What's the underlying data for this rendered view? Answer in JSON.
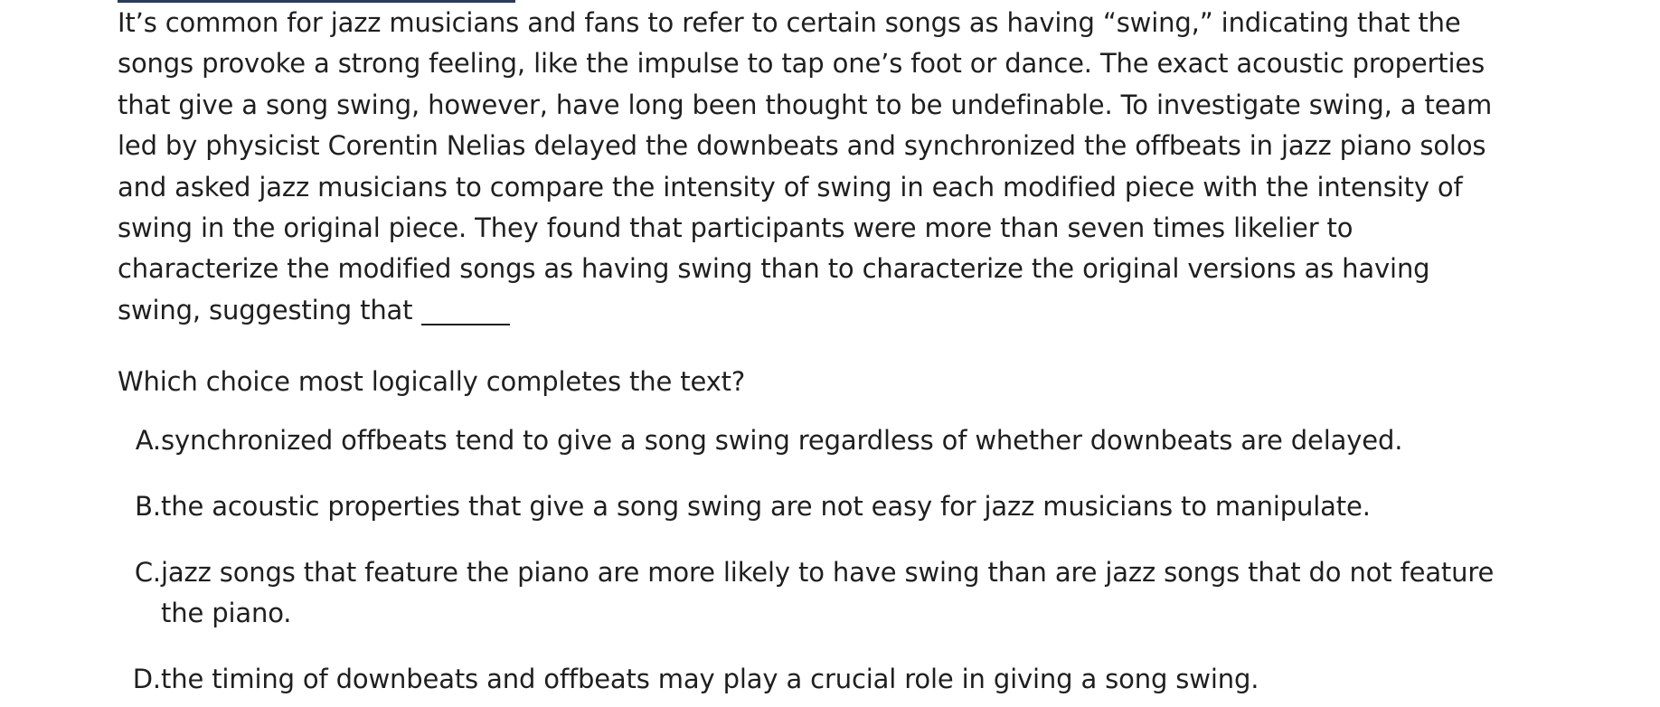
{
  "passage": {
    "text": "It’s common for jazz musicians and fans to refer to certain songs as having “swing,” indicating that the songs provoke a strong feeling, like the impulse to tap one’s foot or dance. The exact acoustic properties that give a song swing, however, have long been thought to be undefinable. To investigate swing, a team led by physicist Corentin Nelias delayed the downbeats and synchronized the offbeats in jazz piano solos and asked jazz musicians to compare the intensity of swing in each modified piece with the intensity of swing in the original piece. They found that participants were more than seven times likelier to characterize the modified songs as having swing than to characterize the original versions as having swing, suggesting that"
  },
  "question": {
    "prompt": "Which choice most logically completes the text?"
  },
  "choices": [
    {
      "letter": "A.",
      "text": "synchronized offbeats tend to give a song swing regardless of whether downbeats are delayed."
    },
    {
      "letter": "B.",
      "text": "the acoustic properties that give a song swing are not easy for jazz musicians to manipulate."
    },
    {
      "letter": "C.",
      "text": "jazz songs that feature the piano are more likely to have swing than are jazz songs that do not feature the piano."
    },
    {
      "letter": "D.",
      "text": "the timing of downbeats and offbeats may play a crucial role in giving a song swing."
    }
  ]
}
